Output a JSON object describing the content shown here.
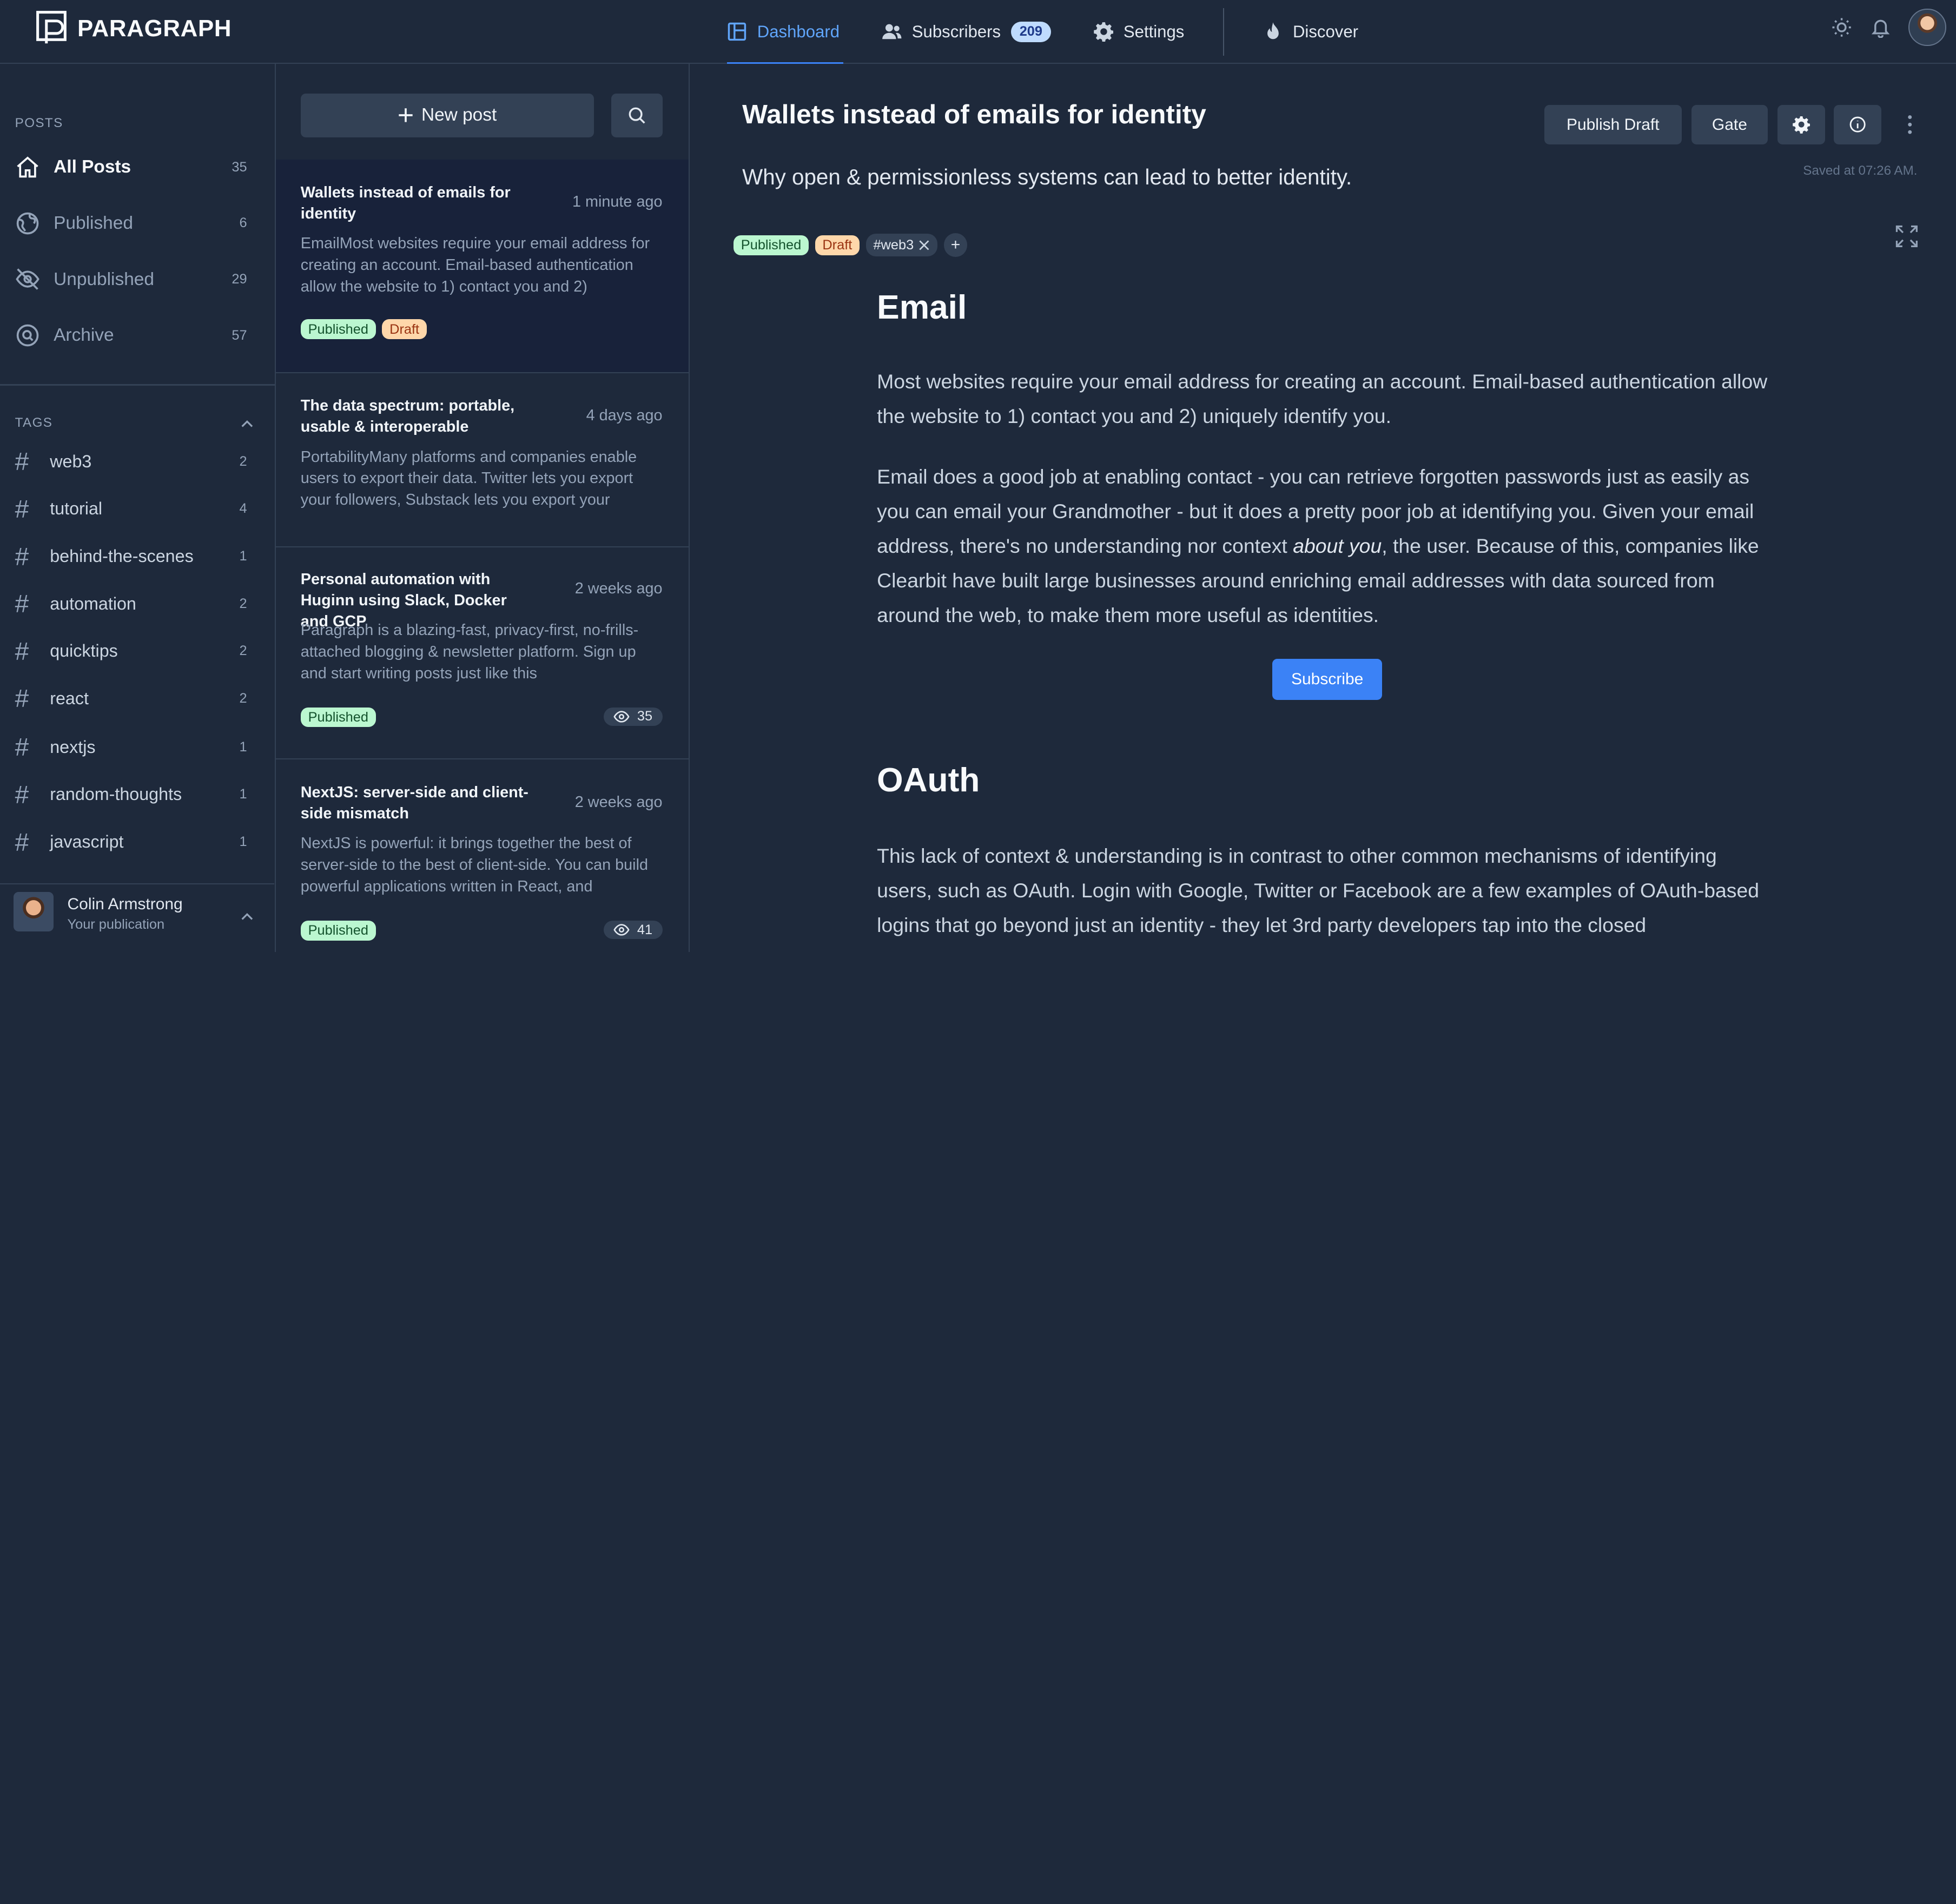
{
  "app": {
    "logo_text": "PARAGRAPH"
  },
  "nav": {
    "dashboard": "Dashboard",
    "subscribers": "Subscribers",
    "subscribers_count": "209",
    "settings": "Settings",
    "discover": "Discover"
  },
  "sidebar": {
    "posts_heading": "POSTS",
    "links": [
      {
        "label": "All Posts",
        "count": "35"
      },
      {
        "label": "Published",
        "count": "6"
      },
      {
        "label": "Unpublished",
        "count": "29"
      },
      {
        "label": "Archive",
        "count": "57"
      }
    ],
    "tags_heading": "TAGS",
    "tags": [
      {
        "label": "web3",
        "count": "2"
      },
      {
        "label": "tutorial",
        "count": "4"
      },
      {
        "label": "behind-the-scenes",
        "count": "1"
      },
      {
        "label": "automation",
        "count": "2"
      },
      {
        "label": "quicktips",
        "count": "2"
      },
      {
        "label": "react",
        "count": "2"
      },
      {
        "label": "nextjs",
        "count": "1"
      },
      {
        "label": "random-thoughts",
        "count": "1"
      },
      {
        "label": "javascript",
        "count": "1"
      }
    ],
    "user": {
      "name": "Colin Armstrong",
      "subtitle": "Your publication"
    }
  },
  "postlist": {
    "new_post": "New post",
    "posts": [
      {
        "title": "Wallets instead of emails for identity",
        "time": "1 minute ago",
        "excerpt": "EmailMost websites require your email address for creating an account. Email-based authentication allow the website to 1) contact you and 2)",
        "badges": [
          "Published",
          "Draft"
        ]
      },
      {
        "title": "The data spectrum: portable, usable & interoperable",
        "time": "4 days ago",
        "excerpt": "PortabilityMany platforms and companies enable users to export their data. Twitter lets you export your followers, Substack lets you export your"
      },
      {
        "title": "Personal automation with Huginn using Slack, Docker and GCP",
        "time": "2 weeks ago",
        "excerpt": "Paragraph is a blazing-fast, privacy-first, no-frills-attached blogging & newsletter platform. Sign up and start writing posts just like this",
        "badges": [
          "Published"
        ],
        "views": "35"
      },
      {
        "title": "NextJS: server-side and client-side mismatch",
        "time": "2 weeks ago",
        "excerpt": "NextJS is powerful: it brings together the best of server-side to the best of client-side. You can build powerful applications written in React, and",
        "badges": [
          "Published"
        ],
        "views": "41"
      }
    ]
  },
  "editor": {
    "title": "Wallets instead of emails for identity",
    "subtitle": "Why open & permissionless systems can lead to better identity.",
    "publish_draft": "Publish Draft",
    "gate": "Gate",
    "saved": "Saved at 07:26 AM.",
    "chips": {
      "published": "Published",
      "draft": "Draft",
      "tag": "#web3"
    },
    "h_email": "Email",
    "p1": "Most websites require your email address for creating an account. Email-based authentication allow the website to 1) contact you and 2) uniquely identify you.",
    "p2_before": "Email does a good job at enabling contact - you can retrieve forgotten passwords just as easily as you can email your Grandmother - but it does a pretty poor job at identifying you. Given your email address, there's no understanding nor context ",
    "p2_em": "about you",
    "p2_after": ", the user. Because of this, companies like Clearbit have built large businesses around enriching email addresses with data sourced from around the web, to make them more useful as identities.",
    "subscribe": "Subscribe",
    "h_oauth": "OAuth",
    "p3": "This lack of context & understanding is in contrast to other common mechanisms of identifying users, such as OAuth. Login with Google, Twitter or Facebook are a few examples of OAuth-based logins that go beyond just an identity - they let 3rd party developers tap into the closed"
  },
  "colors": {
    "accent": "#3b82f6",
    "background": "#1e293b",
    "published": "#bbf7d0",
    "draft": "#fed7aa"
  }
}
